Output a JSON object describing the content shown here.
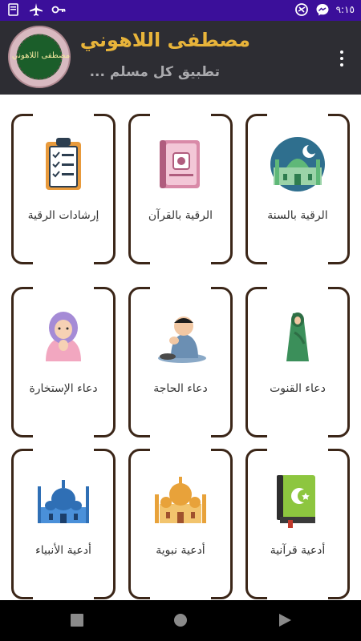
{
  "status_bar": {
    "time": "٩:١٥",
    "left_icons": [
      "app-notification-icon",
      "airplane-icon",
      "key-icon"
    ],
    "right_icons": [
      "vpn-icon",
      "messenger-icon"
    ]
  },
  "header": {
    "title": "مصطفى اللاهوني",
    "subtitle": "تطبيق كل مسلم ...",
    "logo_text": "مصطفى اللاهوني"
  },
  "tiles": [
    {
      "label": "الرقية بالسنة",
      "icon": "mosque-icon"
    },
    {
      "label": "الرقية بالقرآن",
      "icon": "quran-book-icon"
    },
    {
      "label": "إرشادات الرقية",
      "icon": "checklist-clipboard-icon"
    },
    {
      "label": "دعاء القنوت",
      "icon": "praying-woman-icon"
    },
    {
      "label": "دعاء الحاجة",
      "icon": "praying-boy-icon"
    },
    {
      "label": "دعاء الإستخارة",
      "icon": "praying-girl-icon"
    },
    {
      "label": "أدعية قرآنية",
      "icon": "green-quran-icon"
    },
    {
      "label": "أدعية نبوية",
      "icon": "domed-mosque-icon"
    },
    {
      "label": "أدعية الأنبياء",
      "icon": "blue-mosque-icon"
    }
  ],
  "nav_bar": {
    "buttons": [
      "recent-apps-button",
      "home-button",
      "back-button"
    ]
  },
  "colors": {
    "status_bar": "#3b0f9a",
    "header_bg": "#2d2d33",
    "title": "#e8b43a",
    "subtitle": "#a9a9ad",
    "tile_border": "#3b2618"
  }
}
